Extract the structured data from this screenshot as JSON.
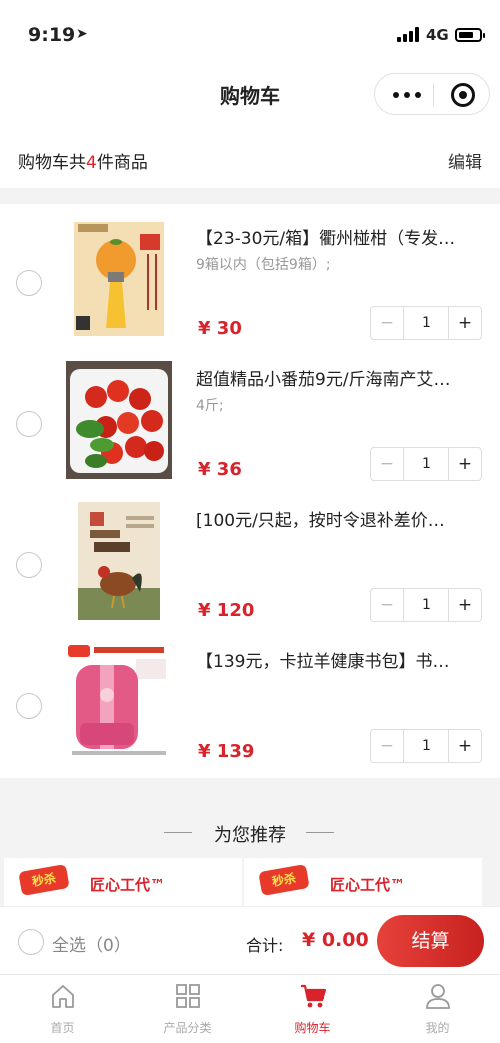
{
  "status_bar": {
    "time": "9:19",
    "network": "4G"
  },
  "nav": {
    "title": "购物车"
  },
  "summary": {
    "prefix": "购物车共",
    "count": "4",
    "suffix": "件商品",
    "edit_label": "编辑"
  },
  "items": [
    {
      "title": "【23-30元/箱】衢州椪柑（专发…",
      "spec": "9箱以内（包括9箱）;",
      "price": "¥ 30",
      "qty": "1"
    },
    {
      "title": "超值精品小番茄9元/斤海南产艾…",
      "spec": "4斤;",
      "price": "¥ 36",
      "qty": "1"
    },
    {
      "title": "[100元/只起，按时令退补差价…",
      "spec": "",
      "price": "¥ 120",
      "qty": "1"
    },
    {
      "title": "【139元，卡拉羊健康书包】书…",
      "spec": "",
      "price": "¥ 139",
      "qty": "1"
    }
  ],
  "stepper": {
    "minus": "−",
    "plus": "+"
  },
  "recommend": {
    "title": "为您推荐",
    "cards": [
      {
        "badge": "秒杀",
        "text": "匠心工代™"
      },
      {
        "badge": "秒杀",
        "text": "匠心工代™"
      }
    ]
  },
  "bottom_bar": {
    "select_all": "全选（0）",
    "total_label": "合计:",
    "total_value": "¥ 0.00",
    "checkout_label": "结算"
  },
  "tabbar": [
    {
      "label": "首页",
      "icon": "home-icon",
      "active": false
    },
    {
      "label": "产品分类",
      "icon": "grid-icon",
      "active": false
    },
    {
      "label": "购物车",
      "icon": "cart-icon",
      "active": true
    },
    {
      "label": "我的",
      "icon": "user-icon",
      "active": false
    }
  ],
  "colors": {
    "accent": "#d9232a",
    "muted": "#999999"
  }
}
